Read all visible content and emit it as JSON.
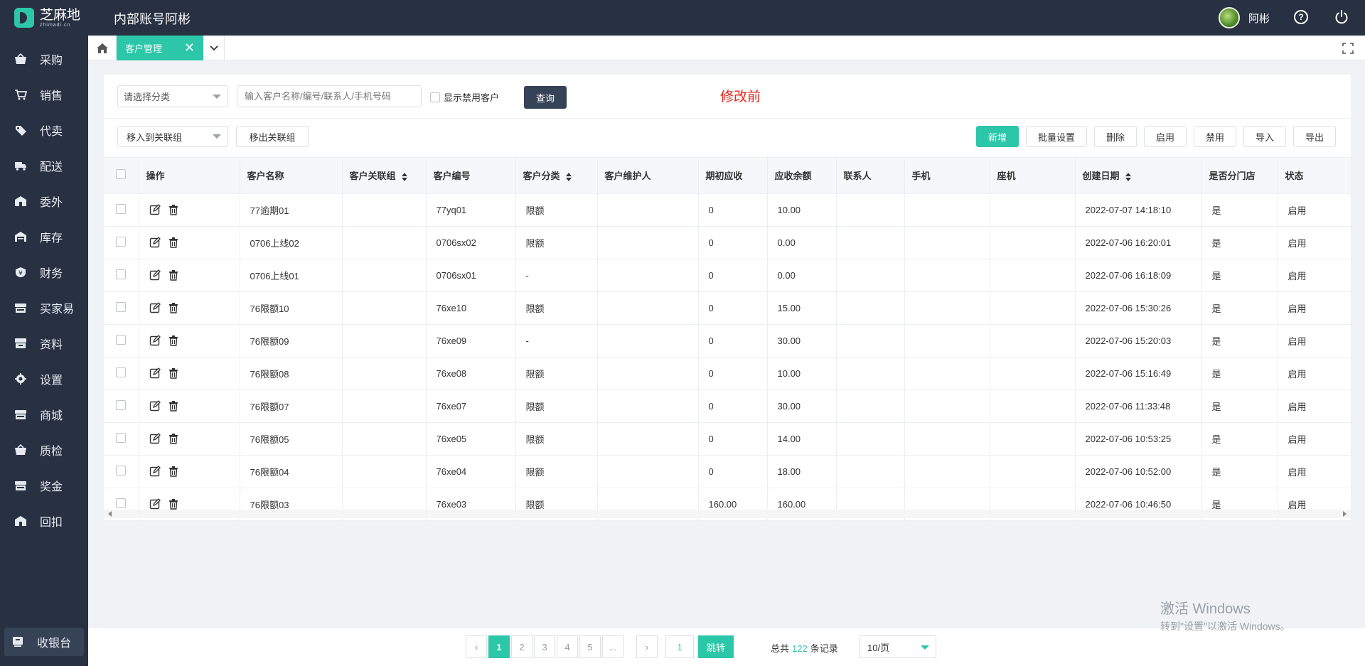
{
  "brand": {
    "name": "芝麻地",
    "sub": "zhimadi.cn"
  },
  "header": {
    "account_title": "内部账号阿彬",
    "user_name": "阿彬"
  },
  "sidebar": {
    "items": [
      {
        "label": "采购",
        "icon": "basket-icon"
      },
      {
        "label": "销售",
        "icon": "cart-icon"
      },
      {
        "label": "代卖",
        "icon": "tag-icon"
      },
      {
        "label": "配送",
        "icon": "truck-icon"
      },
      {
        "label": "委外",
        "icon": "building-icon"
      },
      {
        "label": "库存",
        "icon": "warehouse-icon"
      },
      {
        "label": "财务",
        "icon": "money-icon"
      },
      {
        "label": "买家易",
        "icon": "store-icon"
      },
      {
        "label": "资料",
        "icon": "archive-icon"
      },
      {
        "label": "设置",
        "icon": "gear-icon"
      },
      {
        "label": "商城",
        "icon": "mall-icon"
      },
      {
        "label": "质检",
        "icon": "inspect-icon"
      },
      {
        "label": "奖金",
        "icon": "bonus-icon"
      },
      {
        "label": "回扣",
        "icon": "rebate-icon"
      }
    ],
    "cashier": "收银台"
  },
  "tabs": {
    "active": "客户管理"
  },
  "filters": {
    "category_placeholder": "请选择分类",
    "search_placeholder": "输入客户名称/编号/联系人/手机号码",
    "show_disabled": "显示禁用客户",
    "query": "查询"
  },
  "note": "修改前",
  "actions": {
    "move_in": "移入到关联组",
    "move_out": "移出关联组",
    "add": "新增",
    "batch": "批量设置",
    "delete": "删除",
    "enable": "启用",
    "disable": "禁用",
    "import": "导入",
    "export": "导出"
  },
  "table": {
    "headers": {
      "op": "操作",
      "name": "客户名称",
      "group": "客户关联组",
      "code": "客户编号",
      "category": "客户分类",
      "maintainer": "客户维护人",
      "initial": "期初应收",
      "balance": "应收余额",
      "contact": "联系人",
      "mobile": "手机",
      "phone": "座机",
      "created": "创建日期",
      "branch": "是否分门店",
      "status": "状态"
    },
    "rows": [
      {
        "name": "77逾期01",
        "group": "",
        "code": "77yq01",
        "category": "限额",
        "maintainer": "",
        "initial": "0",
        "balance": "10.00",
        "contact": "",
        "mobile": "",
        "phone": "",
        "created": "2022-07-07 14:18:10",
        "branch": "是",
        "status": "启用"
      },
      {
        "name": "0706上线02",
        "group": "",
        "code": "0706sx02",
        "category": "限额",
        "maintainer": "",
        "initial": "0",
        "balance": "0.00",
        "contact": "",
        "mobile": "",
        "phone": "",
        "created": "2022-07-06 16:20:01",
        "branch": "是",
        "status": "启用"
      },
      {
        "name": "0706上线01",
        "group": "",
        "code": "0706sx01",
        "category": "-",
        "maintainer": "",
        "initial": "0",
        "balance": "0.00",
        "contact": "",
        "mobile": "",
        "phone": "",
        "created": "2022-07-06 16:18:09",
        "branch": "是",
        "status": "启用"
      },
      {
        "name": "76限额10",
        "group": "",
        "code": "76xe10",
        "category": "限额",
        "maintainer": "",
        "initial": "0",
        "balance": "15.00",
        "contact": "",
        "mobile": "",
        "phone": "",
        "created": "2022-07-06 15:30:26",
        "branch": "是",
        "status": "启用"
      },
      {
        "name": "76限额09",
        "group": "",
        "code": "76xe09",
        "category": "-",
        "maintainer": "",
        "initial": "0",
        "balance": "30.00",
        "contact": "",
        "mobile": "",
        "phone": "",
        "created": "2022-07-06 15:20:03",
        "branch": "是",
        "status": "启用"
      },
      {
        "name": "76限额08",
        "group": "",
        "code": "76xe08",
        "category": "限额",
        "maintainer": "",
        "initial": "0",
        "balance": "10.00",
        "contact": "",
        "mobile": "",
        "phone": "",
        "created": "2022-07-06 15:16:49",
        "branch": "是",
        "status": "启用"
      },
      {
        "name": "76限额07",
        "group": "",
        "code": "76xe07",
        "category": "限额",
        "maintainer": "",
        "initial": "0",
        "balance": "30.00",
        "contact": "",
        "mobile": "",
        "phone": "",
        "created": "2022-07-06 11:33:48",
        "branch": "是",
        "status": "启用"
      },
      {
        "name": "76限额05",
        "group": "",
        "code": "76xe05",
        "category": "限额",
        "maintainer": "",
        "initial": "0",
        "balance": "14.00",
        "contact": "",
        "mobile": "",
        "phone": "",
        "created": "2022-07-06 10:53:25",
        "branch": "是",
        "status": "启用"
      },
      {
        "name": "76限额04",
        "group": "",
        "code": "76xe04",
        "category": "限额",
        "maintainer": "",
        "initial": "0",
        "balance": "18.00",
        "contact": "",
        "mobile": "",
        "phone": "",
        "created": "2022-07-06 10:52:00",
        "branch": "是",
        "status": "启用"
      },
      {
        "name": "76限额03",
        "group": "",
        "code": "76xe03",
        "category": "限额",
        "maintainer": "",
        "initial": "160.00",
        "balance": "160.00",
        "contact": "",
        "mobile": "",
        "phone": "",
        "created": "2022-07-06 10:46:50",
        "branch": "是",
        "status": "启用"
      }
    ]
  },
  "pagination": {
    "pages": [
      "1",
      "2",
      "3",
      "4",
      "5",
      "..."
    ],
    "jump_value": "1",
    "jump_label": "跳转",
    "total_prefix": "总共",
    "total_count": "122",
    "total_suffix": "条记录",
    "page_size": "10/页"
  },
  "watermark": {
    "line1": "激活 Windows",
    "line2": "转到\"设置\"以激活 Windows。"
  },
  "colors": {
    "sidebar": "#273142",
    "accent": "#2cc7a8",
    "note": "#e5261b",
    "dark_button": "#364256"
  }
}
